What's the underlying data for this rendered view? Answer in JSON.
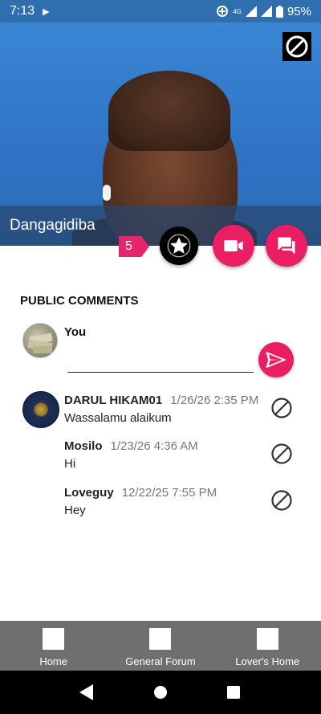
{
  "status_bar": {
    "time": "7:13",
    "battery": "95%",
    "network_label": "4G"
  },
  "profile": {
    "name": "Dangagidiba",
    "count_badge": "5"
  },
  "comments_section": {
    "title": "PUBLIC COMMENTS",
    "you_label": "You",
    "input_value": "",
    "input_placeholder": ""
  },
  "comments": [
    {
      "author": "DARUL HIKAM01",
      "timestamp": "1/26/26 2:35 PM",
      "text": "Wassalamu alaikum"
    },
    {
      "author": "Mosilo",
      "timestamp": "1/23/26 4:36 AM",
      "text": "Hi"
    },
    {
      "author": "Loveguy",
      "timestamp": "12/22/25 7:55 PM",
      "text": "Hey"
    }
  ],
  "bottom_nav": {
    "items": [
      {
        "label": "Home"
      },
      {
        "label": "General Forum"
      },
      {
        "label": "Lover's Home"
      }
    ]
  },
  "colors": {
    "accent": "#e91e63",
    "status_bar": "#2f6fb0",
    "bottom_nav": "#6f6f6f"
  },
  "icons": {
    "block": "block-icon",
    "star": "star-icon",
    "video": "videocam-icon",
    "chat": "forum-icon",
    "send": "send-icon"
  }
}
